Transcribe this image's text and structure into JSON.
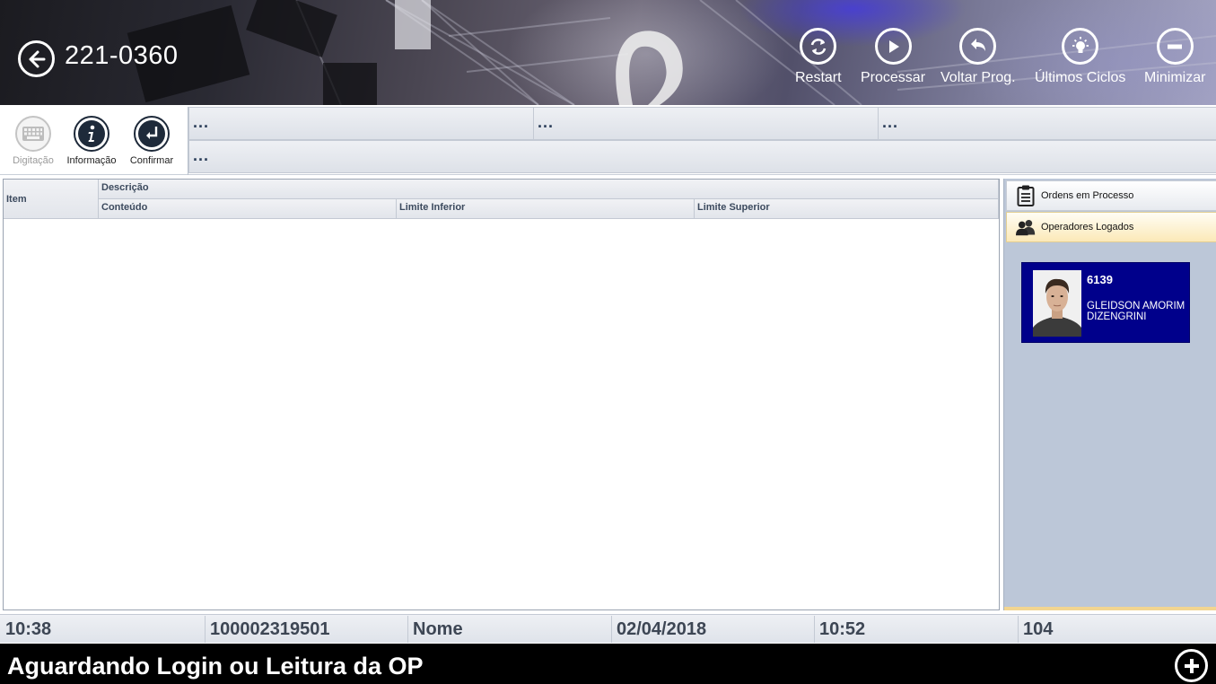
{
  "header": {
    "title": "221-0360",
    "buttons": [
      {
        "label": "Restart",
        "icon": "refresh-icon"
      },
      {
        "label": "Processar",
        "icon": "play-icon"
      },
      {
        "label": "Voltar Prog.",
        "icon": "undo-icon"
      },
      {
        "label": "Últimos Ciclos",
        "icon": "lightbulb-icon"
      },
      {
        "label": "Minimizar",
        "icon": "minus-icon"
      }
    ]
  },
  "toolbar": {
    "buttons": [
      {
        "label": "Digitação",
        "icon": "keyboard-icon",
        "enabled": false
      },
      {
        "label": "Informação",
        "icon": "info-icon",
        "enabled": true
      },
      {
        "label": "Confirmar",
        "icon": "enter-icon",
        "enabled": true
      }
    ],
    "info_cells": [
      "...",
      "...",
      "...",
      "..."
    ]
  },
  "grid": {
    "columns": {
      "item": "Item",
      "descricao": "Descrição",
      "conteudo": "Conteúdo",
      "limite_inferior": "Limite Inferior",
      "limite_superior": "Limite Superior"
    },
    "rows": []
  },
  "side_panel": {
    "tabs": [
      {
        "label": "Ordens em Processo",
        "icon": "clipboard-icon"
      },
      {
        "label": "Operadores Logados",
        "icon": "users-icon",
        "active": true
      }
    ],
    "operator": {
      "code": "6139",
      "name": "GLEIDSON AMORIM DIZENGRINI"
    }
  },
  "status_bar": {
    "cells": [
      "10:38",
      "100002319501",
      "Nome",
      "02/04/2018",
      "10:52",
      "104"
    ]
  },
  "message_bar": {
    "text": "Aguardando Login ou Leitura da OP"
  },
  "colors": {
    "operator_card": "#00008b",
    "active_tab": "#fbe9b8",
    "message_bar": "#000000"
  }
}
